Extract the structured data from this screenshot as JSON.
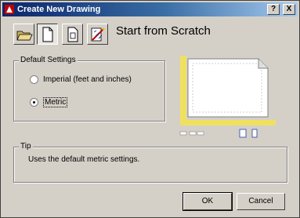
{
  "window": {
    "title": "Create New Drawing",
    "help_label": "?",
    "close_label": "X"
  },
  "toolbar": {
    "options": [
      {
        "name": "open-drawing",
        "icon": "folder-open-icon"
      },
      {
        "name": "start-from-scratch",
        "icon": "blank-page-icon",
        "pressed": true
      },
      {
        "name": "use-a-template",
        "icon": "template-page-icon"
      },
      {
        "name": "use-a-wizard",
        "icon": "wizard-wand-icon"
      }
    ],
    "heading": "Start from Scratch"
  },
  "default_settings": {
    "label": "Default Settings",
    "options": [
      {
        "label": "Imperial (feet and inches)",
        "checked": false
      },
      {
        "label": "Metric",
        "checked": true
      }
    ]
  },
  "tip": {
    "label": "Tip",
    "text": "Uses the default metric settings."
  },
  "buttons": {
    "ok": "OK",
    "cancel": "Cancel"
  },
  "colors": {
    "title_start": "#0a246a",
    "title_end": "#a6caf0",
    "face": "#d4d0c8",
    "preview_ruler": "#f0e060"
  }
}
